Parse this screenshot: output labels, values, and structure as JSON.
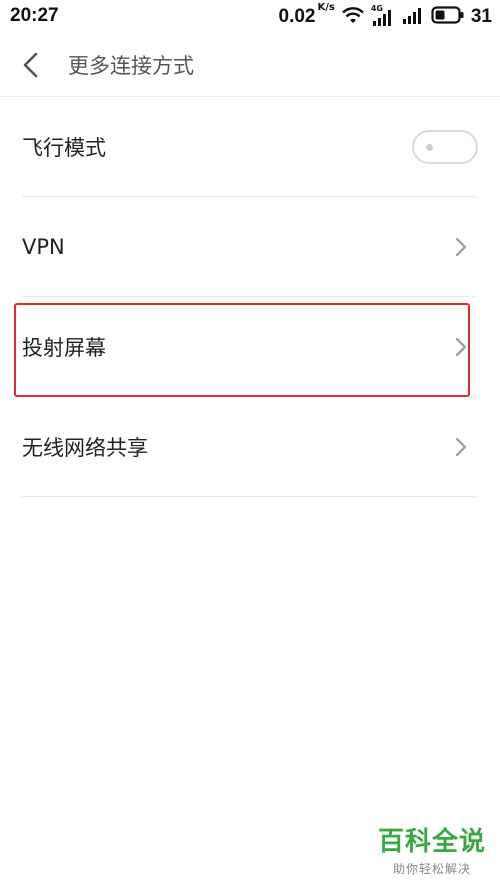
{
  "status_bar": {
    "time": "20:27",
    "net_speed": "0.02",
    "net_unit": "K/s",
    "network_type": "4G",
    "battery": "31",
    "icons": [
      "wifi-icon",
      "signal-4g-icon",
      "signal-icon",
      "battery-icon"
    ]
  },
  "header": {
    "title": "更多连接方式",
    "back_icon": "chevron-left-icon"
  },
  "list": {
    "items": [
      {
        "label": "飞行模式",
        "control": "toggle",
        "toggle_on": false
      },
      {
        "label": "VPN",
        "control": "chevron"
      },
      {
        "label": "投射屏幕",
        "control": "chevron",
        "highlighted": true
      },
      {
        "label": "无线网络共享",
        "control": "chevron"
      }
    ]
  },
  "watermark": {
    "main": "百科全说",
    "sub": "助你轻松解决"
  },
  "colors": {
    "highlight": "#e02b2b",
    "watermark_green": "#3aa845",
    "divider": "#e9e9e9"
  }
}
